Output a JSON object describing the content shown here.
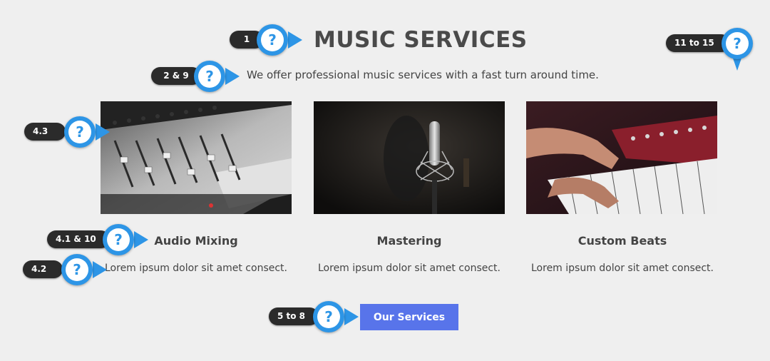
{
  "header": {
    "title": "MUSIC SERVICES",
    "subtitle": "We offer professional music services with a fast turn around time."
  },
  "cards": [
    {
      "title": "Audio Mixing",
      "description": "Lorem ipsum dolor sit amet consect.",
      "image": "mixing-console-photo"
    },
    {
      "title": "Mastering",
      "description": "Lorem ipsum dolor sit amet consect.",
      "image": "studio-microphone-photo"
    },
    {
      "title": "Custom Beats",
      "description": "Lorem ipsum dolor sit amet consect.",
      "image": "synth-keyboard-photo"
    }
  ],
  "cta": {
    "label": "Our Services"
  },
  "markers": {
    "m1": "1",
    "m2": "2 & 9",
    "m3": "11 to 15",
    "m4": "4.3",
    "m5": "4.1 & 10",
    "m6": "4.2",
    "m7": "5 to 8",
    "glyph": "?"
  },
  "colors": {
    "accent_button": "#5874ea",
    "marker_blue": "#2d95e6",
    "marker_pill": "#2b2b2b",
    "background": "#efefef"
  }
}
